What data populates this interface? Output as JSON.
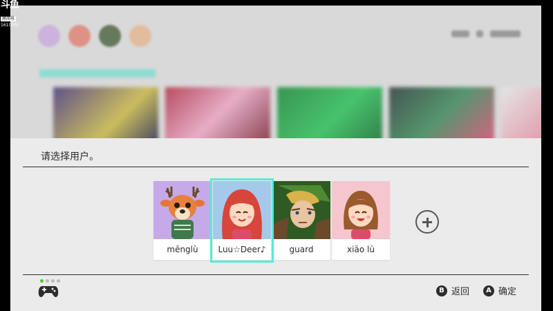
{
  "watermark": {
    "logo": "斗鱼",
    "sub": "房间号",
    "room": "1610001"
  },
  "prompt": {
    "title": "请选择用户。"
  },
  "users": [
    {
      "name": "mēnglù",
      "avatar": "deer-villager-avatar",
      "bg_color": "#c6a9e8",
      "selected": false
    },
    {
      "name": "Luu☆Deer♪",
      "avatar": "mii-red-hair-avatar",
      "bg_color": "#a5c9e8",
      "selected": true
    },
    {
      "name": "guard",
      "avatar": "link-hero-avatar",
      "bg_color": "#3d6a2b",
      "selected": false
    },
    {
      "name": "xiāo lù",
      "avatar": "mii-brown-hair-avatar",
      "bg_color": "#f5c6cd",
      "selected": false
    }
  ],
  "add_user": {
    "icon": "plus-icon"
  },
  "footer": {
    "controller_icon": "controller-icon",
    "hints": [
      {
        "button": "B",
        "label": "返回"
      },
      {
        "button": "A",
        "label": "确定"
      }
    ]
  },
  "colors": {
    "accent": "#5ee7d6",
    "sheet_bg": "#ebebeb",
    "text": "#2d2d2d"
  }
}
